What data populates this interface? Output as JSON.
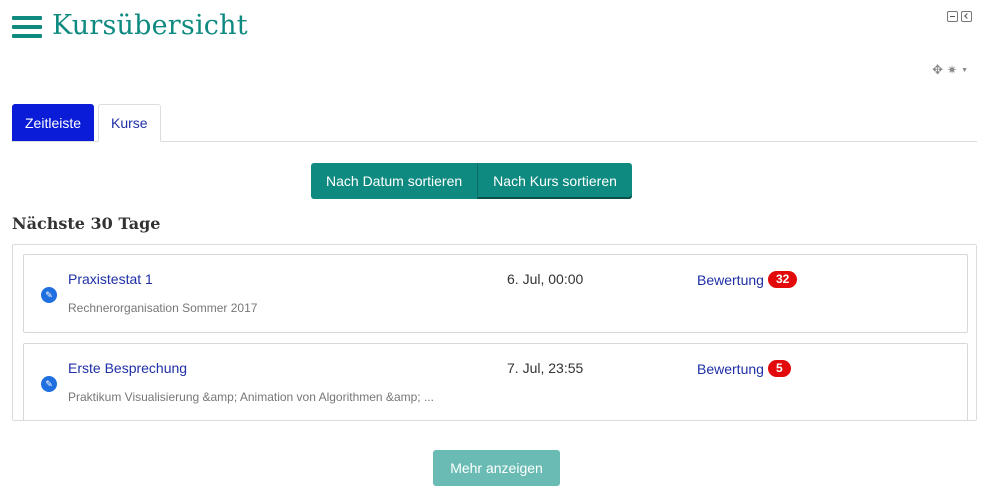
{
  "header": {
    "title": "Kursübersicht"
  },
  "icons": {
    "menu": "hamburger-icon",
    "minimize": "minimize-icon",
    "dock": "dock-icon",
    "move": "move-icon",
    "settings": "gear-icon"
  },
  "colors": {
    "brand": "#0f8a80",
    "tab_active": "#0a1cd8",
    "link": "#1e2fa8",
    "badge": "#e20a0a"
  },
  "tabs": [
    {
      "label": "Zeitleiste",
      "active": true
    },
    {
      "label": "Kurse",
      "active": false
    }
  ],
  "sort": {
    "by_date": "Nach Datum sortieren",
    "by_course": "Nach Kurs sortieren"
  },
  "section": {
    "title": "Nächste 30 Tage"
  },
  "events": [
    {
      "name": "Praxistestat 1",
      "course": "Rechnerorganisation Sommer 2017",
      "date": "6. Jul, 00:00",
      "action": "Bewertung",
      "count": "32"
    },
    {
      "name": "Erste Besprechung",
      "course": "Praktikum Visualisierung &amp; Animation von Algorithmen &amp; ...",
      "date": "7. Jul, 23:55",
      "action": "Bewertung",
      "count": "5"
    }
  ],
  "more": {
    "label": "Mehr anzeigen"
  }
}
